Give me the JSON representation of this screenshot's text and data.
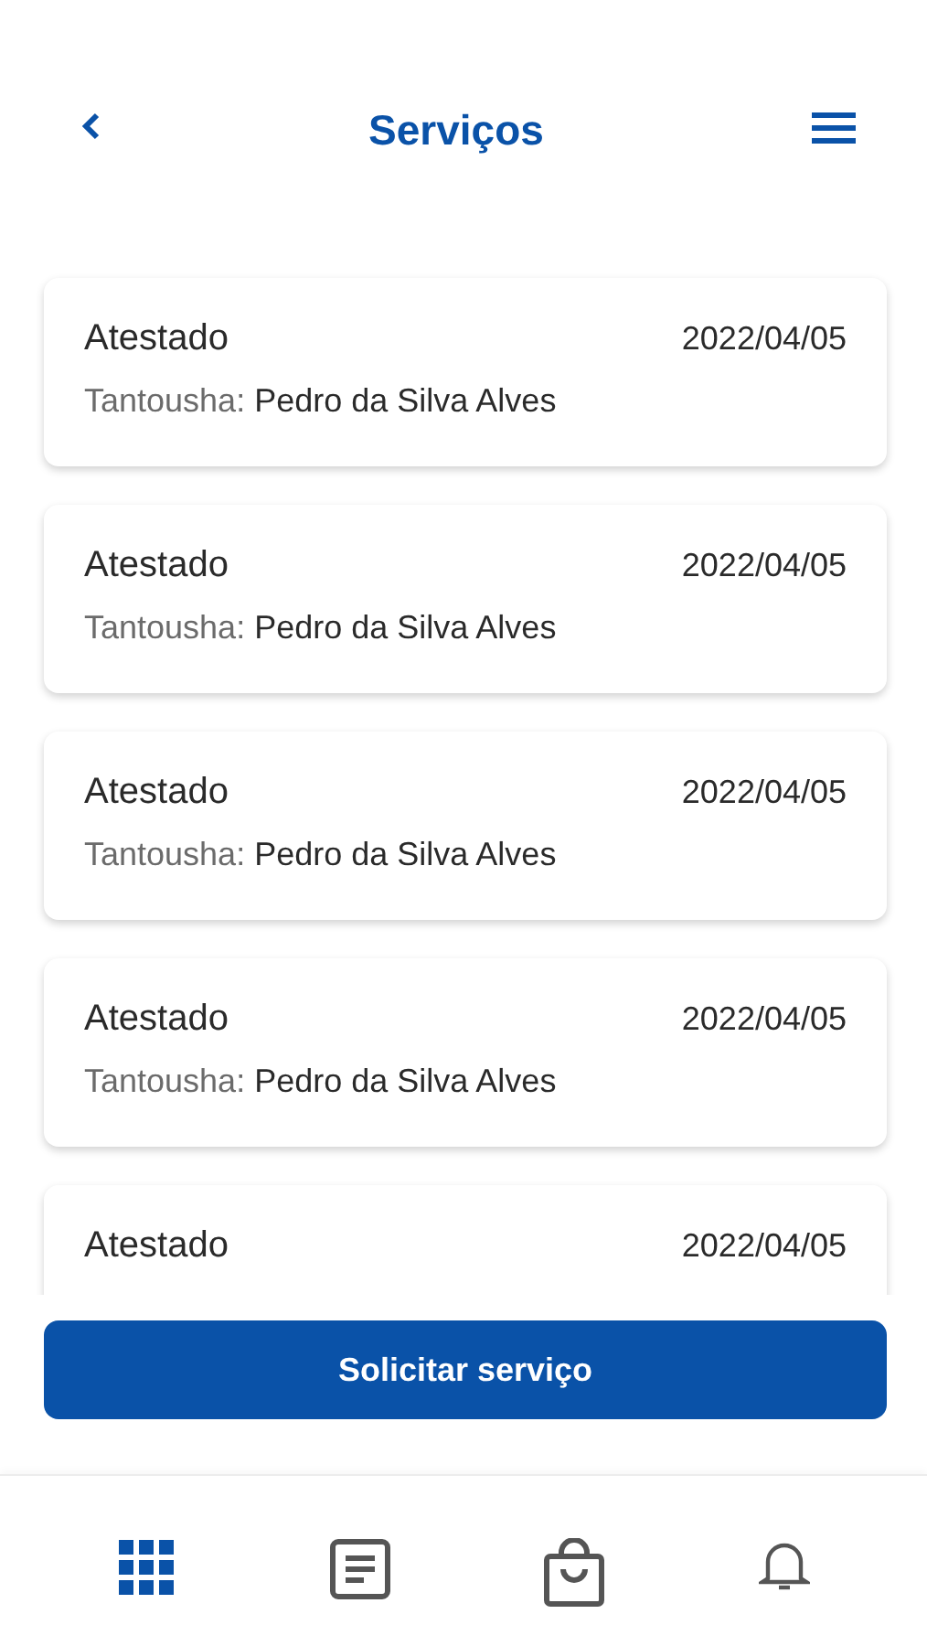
{
  "header": {
    "title": "Serviços"
  },
  "services": [
    {
      "title": "Atestado",
      "date": "2022/04/05",
      "holder_label": "Tantousha:",
      "holder_name": "Pedro da Silva Alves"
    },
    {
      "title": "Atestado",
      "date": "2022/04/05",
      "holder_label": "Tantousha:",
      "holder_name": "Pedro da Silva Alves"
    },
    {
      "title": "Atestado",
      "date": "2022/04/05",
      "holder_label": "Tantousha:",
      "holder_name": "Pedro da Silva Alves"
    },
    {
      "title": "Atestado",
      "date": "2022/04/05",
      "holder_label": "Tantousha:",
      "holder_name": "Pedro da Silva Alves"
    },
    {
      "title": "Atestado",
      "date": "2022/04/05"
    }
  ],
  "action_button": "Solicitar serviço",
  "bottom_nav": [
    {
      "kind": "grid",
      "selected": true
    },
    {
      "kind": "document",
      "selected": false
    },
    {
      "kind": "bag",
      "selected": false
    },
    {
      "kind": "bell",
      "selected": false
    }
  ]
}
